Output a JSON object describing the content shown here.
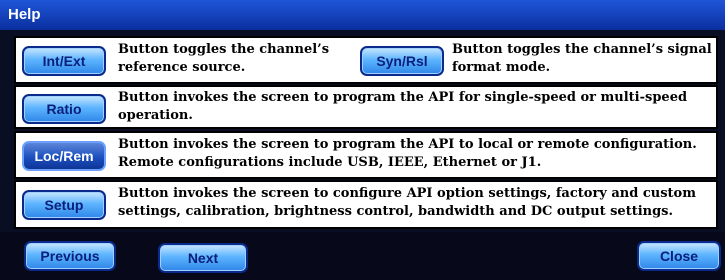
{
  "window": {
    "title": "Help"
  },
  "rows": {
    "intext": {
      "button": "Int/Ext",
      "text": "Button toggles the channel’s reference source."
    },
    "synrsl": {
      "button": "Syn/Rsl",
      "text": "Button toggles the channel’s signal format mode."
    },
    "ratio": {
      "button": "Ratio",
      "text": "Button invokes the screen to program the API for single-speed or multi-speed operation."
    },
    "locrem": {
      "button": "Loc/Rem",
      "text": "Button invokes the screen to program the API to local or remote configuration. Remote configurations include USB, IEEE, Ethernet or J1."
    },
    "setup": {
      "button": "Setup",
      "text": "Button invokes the screen to configure API option settings, factory and custom settings, calibration, brightness control, bandwidth and DC output settings."
    }
  },
  "footer": {
    "previous": "Previous",
    "next": "Next",
    "close": "Close"
  }
}
